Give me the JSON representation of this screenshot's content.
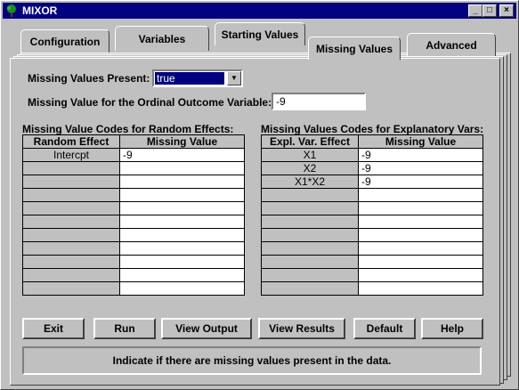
{
  "window": {
    "title": "MIXOR",
    "min": "_",
    "max": "□",
    "close": "×"
  },
  "tabs": [
    {
      "label": "Configuration"
    },
    {
      "label": "Variables"
    },
    {
      "label": "Starting Values"
    },
    {
      "label": "Missing Values"
    },
    {
      "label": "Advanced"
    }
  ],
  "active_tab": "Missing Values",
  "form": {
    "missing_present_label": "Missing Values Present:",
    "missing_present_value": "true",
    "ordinal_label": "Missing Value for the Ordinal Outcome Variable:",
    "ordinal_value": "-9"
  },
  "random_effects": {
    "title": "Missing Value Codes for Random Effects:",
    "headers": [
      "Random Effect",
      "Missing Value"
    ],
    "rows": [
      [
        "Intercpt",
        "-9"
      ],
      [
        "",
        ""
      ],
      [
        "",
        ""
      ],
      [
        "",
        ""
      ],
      [
        "",
        ""
      ],
      [
        "",
        ""
      ],
      [
        "",
        ""
      ],
      [
        "",
        ""
      ],
      [
        "",
        ""
      ],
      [
        "",
        ""
      ],
      [
        "",
        ""
      ]
    ]
  },
  "explanatory": {
    "title": "Missing Values Codes for Explanatory Vars:",
    "headers": [
      "Expl. Var. Effect",
      "Missing Value"
    ],
    "rows": [
      [
        "X1",
        "-9"
      ],
      [
        "X2",
        "-9"
      ],
      [
        "X1*X2",
        "-9"
      ],
      [
        "",
        ""
      ],
      [
        "",
        ""
      ],
      [
        "",
        ""
      ],
      [
        "",
        ""
      ],
      [
        "",
        ""
      ],
      [
        "",
        ""
      ],
      [
        "",
        ""
      ],
      [
        "",
        ""
      ]
    ]
  },
  "buttons": [
    "Exit",
    "Run",
    "View Output",
    "View Results",
    "Default",
    "Help"
  ],
  "status_text": "Indicate if there are missing values present in the data.",
  "colors": {
    "titlebar": "#000080",
    "face": "#c0c0c0"
  }
}
